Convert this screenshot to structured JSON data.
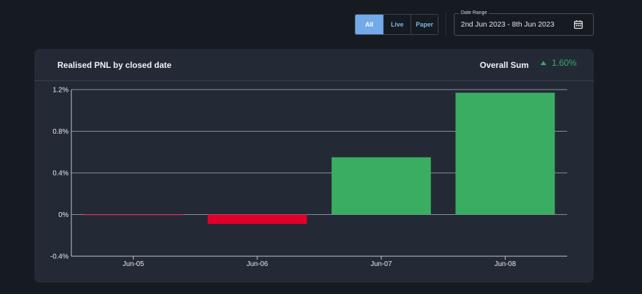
{
  "toolbar": {
    "modes": [
      {
        "label": "All",
        "active": true
      },
      {
        "label": "Live",
        "active": false
      },
      {
        "label": "Paper",
        "active": false
      }
    ],
    "date_range": {
      "legend": "Date Range",
      "value": "2nd Jun 2023 - 8th Jun 2023",
      "icon": "calendar-icon"
    }
  },
  "card": {
    "title": "Realised PNL by closed date",
    "overall_label": "Overall Sum",
    "overall_value": "1.60%",
    "overall_trend": "up"
  },
  "colors": {
    "positive": "#3aad62",
    "negative": "#e0002a",
    "accent": "#72aaea"
  },
  "chart_data": {
    "type": "bar",
    "title": "",
    "xlabel": "",
    "ylabel": "",
    "categories": [
      "Jun-05",
      "Jun-06",
      "Jun-07",
      "Jun-08"
    ],
    "values": [
      -0.005,
      -0.09,
      0.55,
      1.17
    ],
    "ylim": [
      -0.4,
      1.2
    ],
    "yticks": [
      -0.4,
      0,
      0.4,
      0.8,
      1.2
    ],
    "ytick_labels": [
      "-0.4%",
      "0%",
      "0.4%",
      "0.8%",
      "1.2%"
    ],
    "grid": true,
    "legend": "none"
  }
}
